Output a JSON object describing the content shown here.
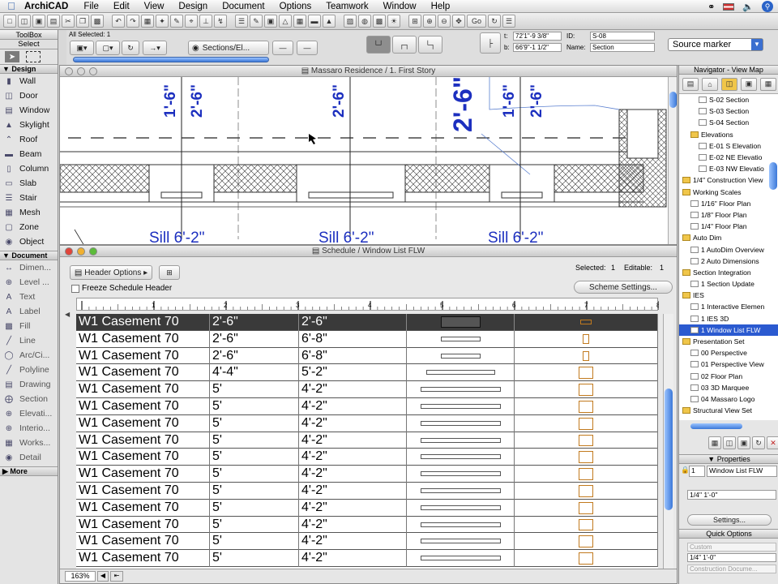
{
  "menubar": {
    "app": "ArchiCAD",
    "items": [
      "File",
      "Edit",
      "View",
      "Design",
      "Document",
      "Options",
      "Teamwork",
      "Window",
      "Help"
    ]
  },
  "toolbar": {
    "all_selected": "All Selected: 1",
    "sections_label": "Sections/El...",
    "coord_t": "t:",
    "coord_t_val": "72'1\"-9 3/8\"",
    "coord_b": "b:",
    "coord_b_val": "66'9\"-1 1/2\"",
    "id_label": "ID:",
    "id_value": "S-08",
    "name_label": "Name:",
    "name_value": "Section",
    "marker_select": "Source marker",
    "go_label": "Go"
  },
  "toolbox": {
    "title": "ToolBox",
    "select_label": "Select",
    "design_header": "Design",
    "design_tools": [
      "Wall",
      "Door",
      "Window",
      "Skylight",
      "Roof",
      "Beam",
      "Column",
      "Slab",
      "Stair",
      "Mesh",
      "Zone",
      "Object"
    ],
    "document_header": "Document",
    "document_tools": [
      "Dimen...",
      "Level ...",
      "Text",
      "Label",
      "Fill",
      "Line",
      "Arc/Ci...",
      "Polyline",
      "Drawing",
      "Section",
      "Elevati...",
      "Interio...",
      "Works...",
      "Detail"
    ],
    "more_label": "More"
  },
  "plan_window": {
    "title": "Massaro Residence / 1. First Story",
    "dims": [
      "1'-6\"",
      "2'-6\"",
      "2'-6\"",
      "2'-6\"",
      "1'-6\"",
      "2'-6\""
    ],
    "sills": [
      "Sill 6'-2\"",
      "Sill 6'-2\"",
      "Sill 6'-2\""
    ]
  },
  "schedule": {
    "title": "Schedule / Window List FLW",
    "header_options": "Header Options",
    "freeze_label": "Freeze Schedule Header",
    "selected_label": "Selected:",
    "selected_value": "1",
    "editable_label": "Editable:",
    "editable_value": "1",
    "scheme_button": "Scheme Settings...",
    "ruler": [
      "1",
      "2",
      "3",
      "4",
      "5",
      "6",
      "7",
      "8"
    ],
    "zoom": "163%",
    "rows": [
      {
        "name": "W1 Casement 70",
        "width": "2'-6\"",
        "height": "2'-6\"",
        "elev_w": 0.37,
        "plan_h": 0.28,
        "sel": true
      },
      {
        "name": "W1 Casement 70",
        "width": "2'-6\"",
        "height": "6'-8\"",
        "elev_w": 0.37,
        "plan_h": 0.55,
        "sel": false
      },
      {
        "name": "W1 Casement 70",
        "width": "2'-6\"",
        "height": "6'-8\"",
        "elev_w": 0.37,
        "plan_h": 0.55,
        "sel": false
      },
      {
        "name": "W1 Casement 70",
        "width": "4'-4\"",
        "height": "5'-2\"",
        "elev_w": 0.64,
        "plan_h": 0.72,
        "sel": false
      },
      {
        "name": "W1 Casement 70",
        "width": "5'",
        "height": "4'-2\"",
        "elev_w": 0.74,
        "plan_h": 0.72,
        "sel": false
      },
      {
        "name": "W1 Casement 70",
        "width": "5'",
        "height": "4'-2\"",
        "elev_w": 0.74,
        "plan_h": 0.72,
        "sel": false
      },
      {
        "name": "W1 Casement 70",
        "width": "5'",
        "height": "4'-2\"",
        "elev_w": 0.74,
        "plan_h": 0.72,
        "sel": false
      },
      {
        "name": "W1 Casement 70",
        "width": "5'",
        "height": "4'-2\"",
        "elev_w": 0.74,
        "plan_h": 0.72,
        "sel": false
      },
      {
        "name": "W1 Casement 70",
        "width": "5'",
        "height": "4'-2\"",
        "elev_w": 0.74,
        "plan_h": 0.72,
        "sel": false
      },
      {
        "name": "W1 Casement 70",
        "width": "5'",
        "height": "4'-2\"",
        "elev_w": 0.74,
        "plan_h": 0.72,
        "sel": false
      },
      {
        "name": "W1 Casement 70",
        "width": "5'",
        "height": "4'-2\"",
        "elev_w": 0.74,
        "plan_h": 0.72,
        "sel": false
      },
      {
        "name": "W1 Casement 70",
        "width": "5'",
        "height": "4'-2\"",
        "elev_w": 0.74,
        "plan_h": 0.72,
        "sel": false
      },
      {
        "name": "W1 Casement 70",
        "width": "5'",
        "height": "4'-2\"",
        "elev_w": 0.74,
        "plan_h": 0.72,
        "sel": false
      },
      {
        "name": "W1 Casement 70",
        "width": "5'",
        "height": "4'-2\"",
        "elev_w": 0.74,
        "plan_h": 0.72,
        "sel": false
      },
      {
        "name": "W1 Casement 70",
        "width": "5'",
        "height": "4'-2\"",
        "elev_w": 0.74,
        "plan_h": 0.72,
        "sel": false
      }
    ]
  },
  "navigator": {
    "title": "Navigator - View Map",
    "items": [
      {
        "label": "S-02 Section",
        "indent": 2,
        "kind": "view"
      },
      {
        "label": "S-03 Section",
        "indent": 2,
        "kind": "view"
      },
      {
        "label": "S-04 Section",
        "indent": 2,
        "kind": "view"
      },
      {
        "label": "Elevations",
        "indent": 1,
        "kind": "folder"
      },
      {
        "label": "E-01 S Elevation",
        "indent": 2,
        "kind": "view"
      },
      {
        "label": "E-02 NE Elevatio",
        "indent": 2,
        "kind": "view"
      },
      {
        "label": "E-03 NW Elevatio",
        "indent": 2,
        "kind": "view"
      },
      {
        "label": "1/4\" Construction View",
        "indent": 0,
        "kind": "folder"
      },
      {
        "label": "Working Scales",
        "indent": 0,
        "kind": "folder"
      },
      {
        "label": "1/16\" Floor Plan",
        "indent": 1,
        "kind": "view"
      },
      {
        "label": "1/8\" Floor Plan",
        "indent": 1,
        "kind": "view"
      },
      {
        "label": "1/4\" Floor Plan",
        "indent": 1,
        "kind": "view"
      },
      {
        "label": "Auto Dim",
        "indent": 0,
        "kind": "folder"
      },
      {
        "label": "1 AutoDim Overview",
        "indent": 1,
        "kind": "view"
      },
      {
        "label": "2 Auto Dimensions",
        "indent": 1,
        "kind": "view"
      },
      {
        "label": "Section Integration",
        "indent": 0,
        "kind": "folder"
      },
      {
        "label": "1 Section Update",
        "indent": 1,
        "kind": "view"
      },
      {
        "label": "IES",
        "indent": 0,
        "kind": "folder"
      },
      {
        "label": "1 Interactive Elemen",
        "indent": 1,
        "kind": "view"
      },
      {
        "label": "1 IES 3D",
        "indent": 1,
        "kind": "view"
      },
      {
        "label": "1 Window List FLW",
        "indent": 1,
        "kind": "view",
        "sel": true
      },
      {
        "label": "Presentation Set",
        "indent": 0,
        "kind": "folder"
      },
      {
        "label": "00 Perspective",
        "indent": 1,
        "kind": "view"
      },
      {
        "label": "01 Perspective View",
        "indent": 1,
        "kind": "view"
      },
      {
        "label": "02 Floor Plan",
        "indent": 1,
        "kind": "view"
      },
      {
        "label": "03 3D Marquee",
        "indent": 1,
        "kind": "view"
      },
      {
        "label": "04 Massaro Logo",
        "indent": 1,
        "kind": "view"
      },
      {
        "label": "Structural View Set",
        "indent": 0,
        "kind": "folder"
      }
    ],
    "properties_title": "Properties",
    "prop_id": "1",
    "prop_name": "Window List FLW",
    "prop_scale": "1/4\"    1'-0\"",
    "settings_button": "Settings...",
    "quick_title": "Quick Options",
    "quick_custom": "Custom",
    "quick_scale": "1/4\"     1'-0\"",
    "quick_doc": "Construction Docume..."
  },
  "colors": {
    "dim_blue": "#1c2fbf",
    "selection": "#2b5ad0",
    "icon_outline": "#c27a1e"
  }
}
